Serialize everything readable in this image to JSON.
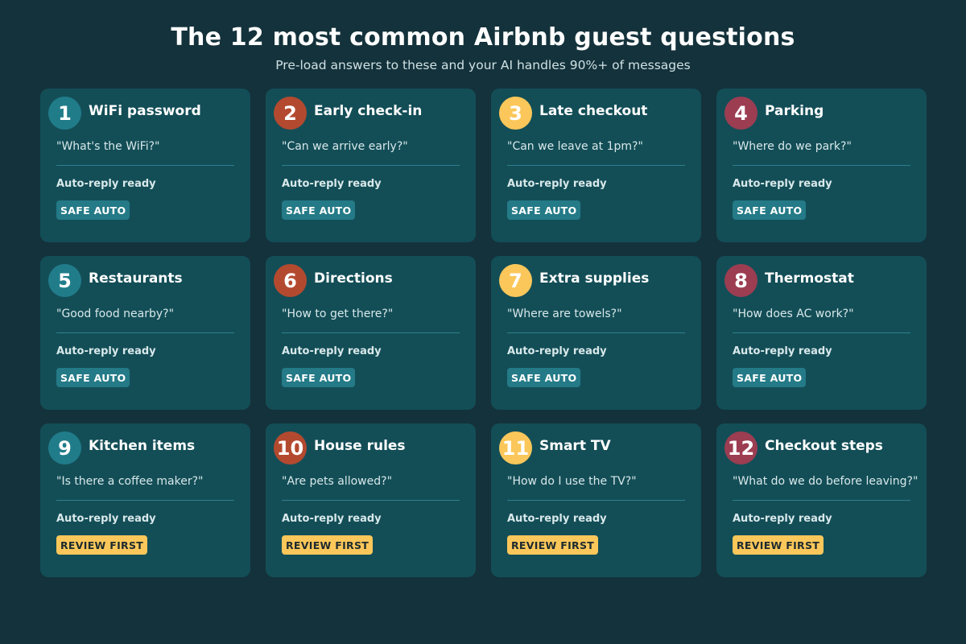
{
  "header": {
    "title": "The 12 most common Airbnb guest questions",
    "subtitle": "Pre-load answers to these and your AI handles 90%+ of messages"
  },
  "colors": {
    "background": "#14323b",
    "card": "#134e57",
    "teal": "#217c8a",
    "rust": "#b34a2f",
    "yellow": "#fbc75a",
    "maroon": "#9c3d52",
    "safe_tag": "#247a87",
    "review_tag": "#fbc75a"
  },
  "cards": [
    {
      "number": "1",
      "title": "WiFi password",
      "quote": "\"What's the WiFi?\"",
      "status": "Auto-reply ready",
      "tag": "SAFE AUTO",
      "tag_type": "safe",
      "badge_color": "#217c8a",
      "badge_text_color": "#ffffff"
    },
    {
      "number": "2",
      "title": "Early check-in",
      "quote": "\"Can we arrive early?\"",
      "status": "Auto-reply ready",
      "tag": "SAFE AUTO",
      "tag_type": "safe",
      "badge_color": "#b34a2f",
      "badge_text_color": "#ffffff"
    },
    {
      "number": "3",
      "title": "Late checkout",
      "quote": "\"Can we leave at 1pm?\"",
      "status": "Auto-reply ready",
      "tag": "SAFE AUTO",
      "tag_type": "safe",
      "badge_color": "#fbc75a",
      "badge_text_color": "#ffffff"
    },
    {
      "number": "4",
      "title": "Parking",
      "quote": "\"Where do we park?\"",
      "status": "Auto-reply ready",
      "tag": "SAFE AUTO",
      "tag_type": "safe",
      "badge_color": "#9c3d52",
      "badge_text_color": "#ffffff"
    },
    {
      "number": "5",
      "title": "Restaurants",
      "quote": "\"Good food nearby?\"",
      "status": "Auto-reply ready",
      "tag": "SAFE AUTO",
      "tag_type": "safe",
      "badge_color": "#217c8a",
      "badge_text_color": "#ffffff"
    },
    {
      "number": "6",
      "title": "Directions",
      "quote": "\"How to get there?\"",
      "status": "Auto-reply ready",
      "tag": "SAFE AUTO",
      "tag_type": "safe",
      "badge_color": "#b34a2f",
      "badge_text_color": "#ffffff"
    },
    {
      "number": "7",
      "title": "Extra supplies",
      "quote": "\"Where are towels?\"",
      "status": "Auto-reply ready",
      "tag": "SAFE AUTO",
      "tag_type": "safe",
      "badge_color": "#fbc75a",
      "badge_text_color": "#ffffff"
    },
    {
      "number": "8",
      "title": "Thermostat",
      "quote": "\"How does AC work?\"",
      "status": "Auto-reply ready",
      "tag": "SAFE AUTO",
      "tag_type": "safe",
      "badge_color": "#9c3d52",
      "badge_text_color": "#ffffff"
    },
    {
      "number": "9",
      "title": "Kitchen items",
      "quote": "\"Is there a coffee maker?\"",
      "status": "Auto-reply ready",
      "tag": "REVIEW FIRST",
      "tag_type": "review",
      "badge_color": "#217c8a",
      "badge_text_color": "#ffffff"
    },
    {
      "number": "10",
      "title": "House rules",
      "quote": "\"Are pets allowed?\"",
      "status": "Auto-reply ready",
      "tag": "REVIEW FIRST",
      "tag_type": "review",
      "badge_color": "#b34a2f",
      "badge_text_color": "#ffffff"
    },
    {
      "number": "11",
      "title": "Smart TV",
      "quote": "\"How do I use the TV?\"",
      "status": "Auto-reply ready",
      "tag": "REVIEW FIRST",
      "tag_type": "review",
      "badge_color": "#fbc75a",
      "badge_text_color": "#ffffff"
    },
    {
      "number": "12",
      "title": "Checkout steps",
      "quote": "\"What do we do before leaving?\"",
      "status": "Auto-reply ready",
      "tag": "REVIEW FIRST",
      "tag_type": "review",
      "badge_color": "#9c3d52",
      "badge_text_color": "#ffffff"
    }
  ]
}
